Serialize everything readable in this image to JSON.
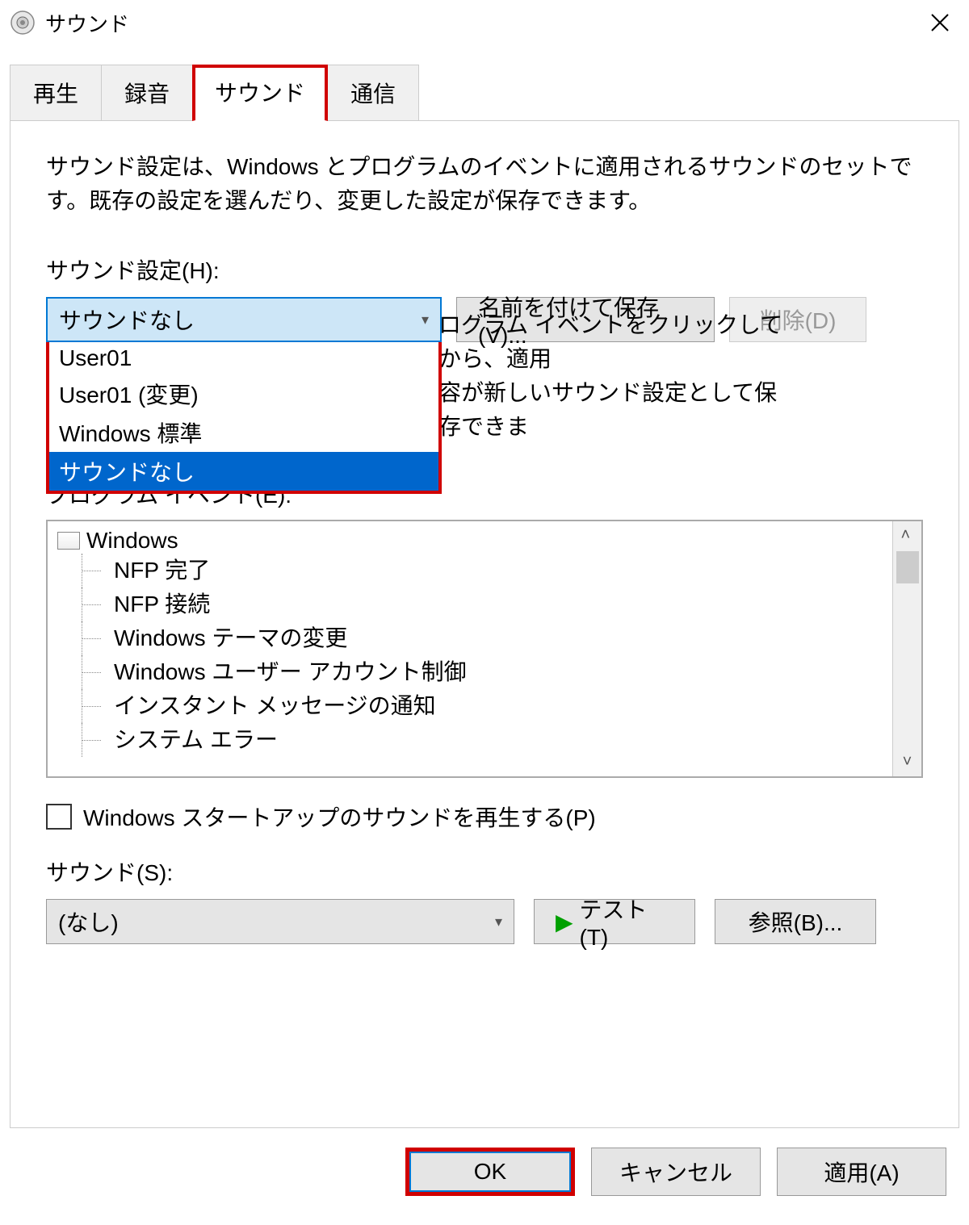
{
  "window": {
    "title": "サウンド"
  },
  "tabs": {
    "playback": "再生",
    "recording": "録音",
    "sounds": "サウンド",
    "communications": "通信"
  },
  "main": {
    "description": "サウンド設定は、Windows とプログラムのイベントに適用されるサウンドのセットです。既存の設定を選んだり、変更した設定が保存できます。",
    "scheme_label": "サウンド設定(H):",
    "scheme_selected": "サウンドなし",
    "scheme_options": [
      "User01",
      "User01 (変更)",
      "Windows 標準",
      "サウンドなし"
    ],
    "save_as": "名前を付けて保存(V)...",
    "delete": "削除(D)",
    "behind_text_pt1": "ログラム イベントをクリックしてから、適用",
    "behind_text_pt2": "容が新しいサウンド設定として保存できま",
    "events_label": "プログラム イベント(E):",
    "events_root": "Windows",
    "events": [
      "NFP 完了",
      "NFP 接続",
      "Windows テーマの変更",
      "Windows ユーザー アカウント制御",
      "インスタント メッセージの通知",
      "システム エラー"
    ],
    "startup_checkbox": "Windows スタートアップのサウンドを再生する(P)",
    "sound_label": "サウンド(S):",
    "sound_value": "(なし)",
    "test": "テスト(T)",
    "browse": "参照(B)..."
  },
  "buttons": {
    "ok": "OK",
    "cancel": "キャンセル",
    "apply": "適用(A)"
  }
}
